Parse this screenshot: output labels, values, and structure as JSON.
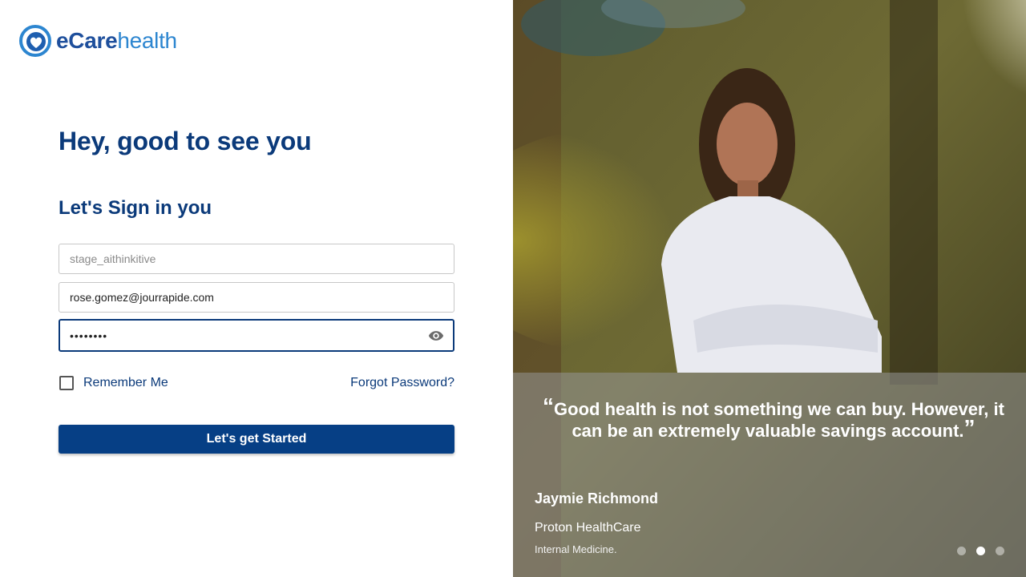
{
  "brand": {
    "name_e": "e",
    "name_care": "Care",
    "name_health": "health",
    "primary_color": "#063f85",
    "accent_color": "#2d86d0"
  },
  "login": {
    "greeting": "Hey, good to see you",
    "subheading": "Let's Sign in you",
    "tenant_placeholder": "stage_aithinkitive",
    "email_value": "rose.gomez@jourrapide.com",
    "password_masked": "••••••••",
    "remember_label": "Remember Me",
    "remember_checked": false,
    "forgot_label": "Forgot Password?",
    "submit_label": "Let's get Started"
  },
  "testimonial": {
    "open_quote": "“",
    "quote": "Good health is not something we can buy. However, it can be an extremely valuable savings account.",
    "close_quote": "”",
    "author": "Jaymie Richmond",
    "organization": "Proton HealthCare",
    "specialty": "Internal Medicine.",
    "slide_count": 3,
    "active_slide": 2
  },
  "icons": {
    "logo": "heart-logo-icon",
    "password_toggle": "eye-icon"
  }
}
